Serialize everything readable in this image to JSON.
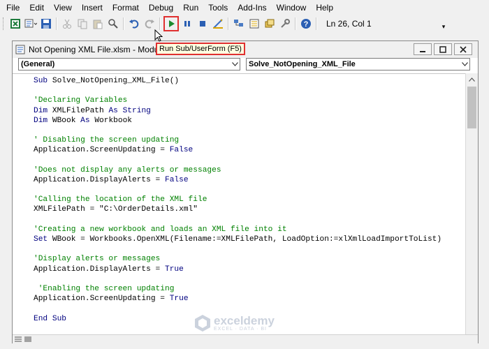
{
  "menu": [
    "File",
    "Edit",
    "View",
    "Insert",
    "Format",
    "Debug",
    "Run",
    "Tools",
    "Add-Ins",
    "Window",
    "Help"
  ],
  "toolbar": {
    "status": "Ln 26, Col 1",
    "buttons": [
      "excel-icon",
      "insert-module-icon",
      "save-icon",
      "cut-icon",
      "copy-icon",
      "paste-icon",
      "find-icon",
      "undo-icon",
      "redo-icon",
      "run-icon",
      "break-icon",
      "reset-icon",
      "design-mode-icon",
      "project-explorer-icon",
      "properties-icon",
      "object-browser-icon",
      "toolbox-icon",
      "help-icon"
    ]
  },
  "window": {
    "title": "Not Opening XML File.xlsm - Module1 (",
    "tooltip": "Run Sub/UserForm (F5)"
  },
  "dropdowns": {
    "object": "(General)",
    "procedure": "Solve_NotOpening_XML_File"
  },
  "code": [
    [
      {
        "t": "Sub ",
        "c": "kw"
      },
      {
        "t": "Solve_NotOpening_XML_File()",
        "c": "tx"
      }
    ],
    [],
    [
      {
        "t": "'Declaring Variables",
        "c": "cm"
      }
    ],
    [
      {
        "t": "Dim ",
        "c": "kw"
      },
      {
        "t": "XMLFilePath ",
        "c": "tx"
      },
      {
        "t": "As ",
        "c": "kw"
      },
      {
        "t": "String",
        "c": "kw"
      }
    ],
    [
      {
        "t": "Dim ",
        "c": "kw"
      },
      {
        "t": "WBook ",
        "c": "tx"
      },
      {
        "t": "As ",
        "c": "kw"
      },
      {
        "t": "Workbook",
        "c": "tx"
      }
    ],
    [],
    [
      {
        "t": "' Disabling the screen updating",
        "c": "cm"
      }
    ],
    [
      {
        "t": "Application.ScreenUpdating = ",
        "c": "tx"
      },
      {
        "t": "False",
        "c": "kw"
      }
    ],
    [],
    [
      {
        "t": "'Does not display any alerts or messages",
        "c": "cm"
      }
    ],
    [
      {
        "t": "Application.DisplayAlerts = ",
        "c": "tx"
      },
      {
        "t": "False",
        "c": "kw"
      }
    ],
    [],
    [
      {
        "t": "'Calling the location of the XML file",
        "c": "cm"
      }
    ],
    [
      {
        "t": "XMLFilePath = \"C:\\OrderDetails.xml\"",
        "c": "tx"
      }
    ],
    [],
    [
      {
        "t": "'Creating a new workbook and loads an XML file into it",
        "c": "cm"
      }
    ],
    [
      {
        "t": "Set ",
        "c": "kw"
      },
      {
        "t": "WBook = Workbooks.OpenXML(Filename:=XMLFilePath, LoadOption:=xlXmlLoadImportToList)",
        "c": "tx"
      }
    ],
    [],
    [
      {
        "t": "'Display alerts or messages",
        "c": "cm"
      }
    ],
    [
      {
        "t": "Application.DisplayAlerts = ",
        "c": "tx"
      },
      {
        "t": "True",
        "c": "kw"
      }
    ],
    [],
    [
      {
        "t": " 'Enabling the screen updating",
        "c": "cm"
      }
    ],
    [
      {
        "t": "Application.ScreenUpdating = ",
        "c": "tx"
      },
      {
        "t": "True",
        "c": "kw"
      }
    ],
    [],
    [
      {
        "t": "End Sub",
        "c": "kw"
      }
    ]
  ],
  "watermark": {
    "main": "exceldemy",
    "sub": "EXCEL · DATA · BI"
  }
}
